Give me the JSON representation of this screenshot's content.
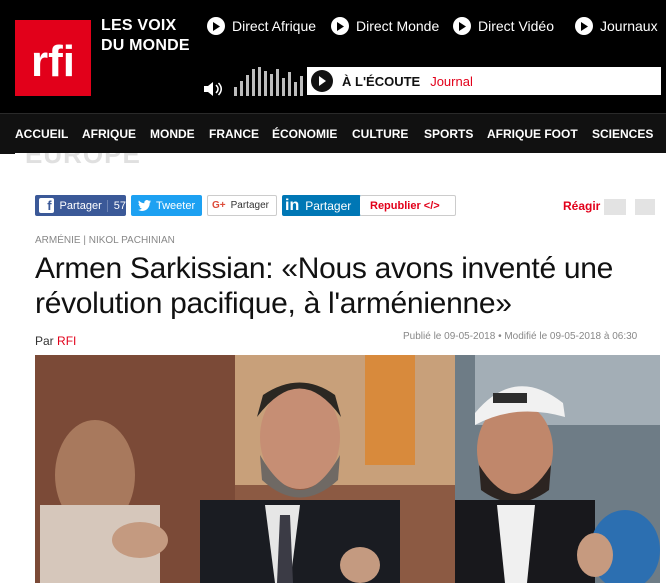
{
  "header": {
    "logo_text": "rfi",
    "tagline_line1": "LES VOIX",
    "tagline_line2": "DU MONDE",
    "direct_links": [
      {
        "label": "Direct Afrique"
      },
      {
        "label": "Direct Monde"
      },
      {
        "label": "Direct Vidéo"
      },
      {
        "label": "Journaux"
      }
    ],
    "player": {
      "listening_label": "À L'ÉCOUTE",
      "program": "Journal"
    }
  },
  "nav": {
    "items": [
      "ACCUEIL",
      "AFRIQUE",
      "MONDE",
      "FRANCE",
      "ÉCONOMIE",
      "CULTURE",
      "SPORTS",
      "AFRIQUE FOOT",
      "SCIENCES"
    ]
  },
  "article": {
    "section": "EUROPE",
    "share": {
      "facebook_label": "Partager",
      "facebook_count": "57",
      "twitter_label": "Tweeter",
      "gplus_label": "Partager",
      "linkedin_label": "Partager",
      "republish_label": "Republier </>"
    },
    "react_label": "Réagir",
    "categories": "ARMÉNIE | NIKOL PACHINIAN",
    "title": "Armen Sarkissian: «Nous avons inventé une révolution pacifique, à l'arménienne»",
    "byline_prefix": "Par",
    "author": "RFI",
    "published": "Publié le 09-05-2018 • Modifié le 09-05-2018 à 06:30"
  },
  "colors": {
    "brand_red": "#e2001a",
    "header_bg": "#000000",
    "facebook": "#3b5998",
    "twitter": "#1da1f2",
    "linkedin": "#0077b5"
  }
}
